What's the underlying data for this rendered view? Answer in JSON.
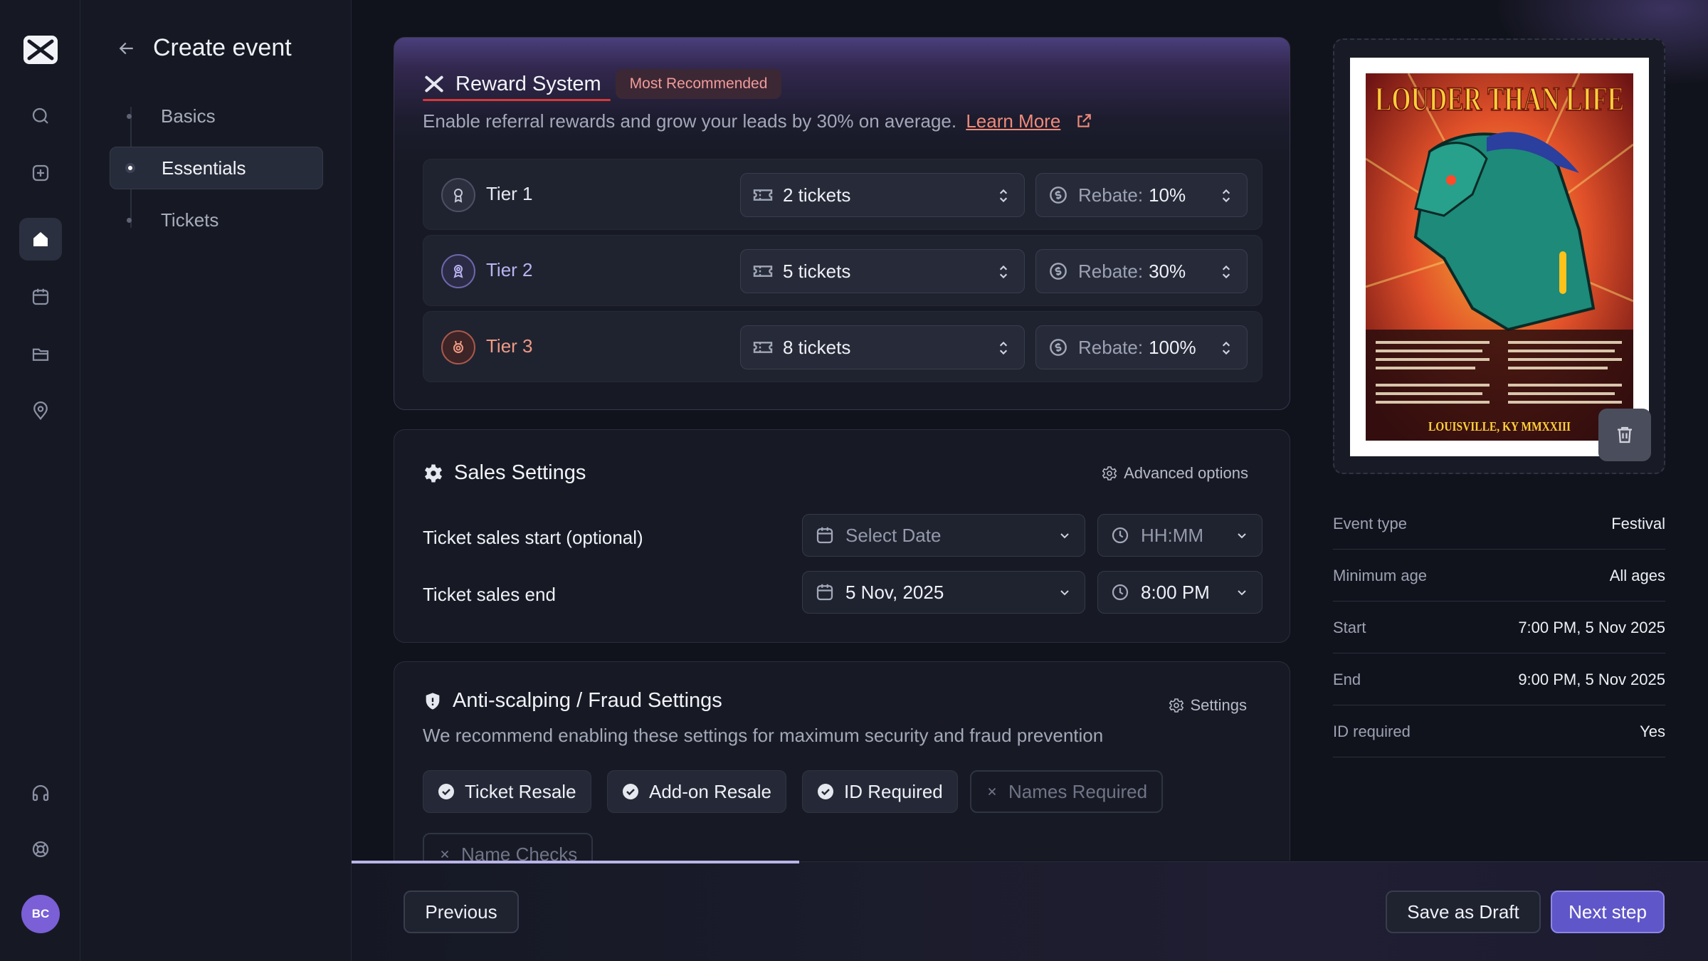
{
  "rail": {
    "avatar_initials": "BC",
    "icons": [
      "search-icon",
      "plus-square-icon",
      "home-icon",
      "calendar-icon",
      "folder-icon",
      "location-pin-icon",
      "headphones-icon",
      "lifebuoy-icon"
    ]
  },
  "steps": {
    "title": "Create event",
    "items": [
      {
        "label": "Basics",
        "active": false
      },
      {
        "label": "Essentials",
        "active": true
      },
      {
        "label": "Tickets",
        "active": false
      }
    ]
  },
  "reward": {
    "title": "Reward System",
    "badge": "Most Recommended",
    "description": "Enable referral rewards and grow your leads by 30% on average.",
    "learn_more": "Learn More",
    "tiers": [
      {
        "label": "Tier 1",
        "tickets": "2 tickets",
        "rebate_label": "Rebate:",
        "rebate": "10%",
        "color": "#e6e8ef"
      },
      {
        "label": "Tier 2",
        "tickets": "5 tickets",
        "rebate_label": "Rebate:",
        "rebate": "30%",
        "color": "#b9b4f0"
      },
      {
        "label": "Tier 3",
        "tickets": "8 tickets",
        "rebate_label": "Rebate:",
        "rebate": "100%",
        "color": "#f09a84"
      }
    ]
  },
  "sales": {
    "title": "Sales Settings",
    "advanced": "Advanced options",
    "start_label": "Ticket sales start (optional)",
    "start_date": "Select Date",
    "start_time": "HH:MM",
    "end_label": "Ticket sales end",
    "end_date": "5 Nov, 2025",
    "end_time": "8:00 PM"
  },
  "fraud": {
    "title": "Anti-scalping / Fraud Settings",
    "settings": "Settings",
    "description": "We recommend enabling these settings for maximum security and fraud prevention",
    "chips": [
      {
        "label": "Ticket Resale",
        "on": true
      },
      {
        "label": "Add-on Resale",
        "on": true
      },
      {
        "label": "ID Required",
        "on": true
      },
      {
        "label": "Names Required",
        "on": false
      },
      {
        "label": "Name Checks",
        "on": false
      }
    ]
  },
  "footer": {
    "previous": "Previous",
    "save_draft": "Save as Draft",
    "next": "Next step",
    "progress_fraction": 0.33
  },
  "poster": {
    "title": "LOUDER THAN LIFE",
    "location": "LOUISVILLE, KY MMXXIII"
  },
  "details": [
    {
      "key": "Event type",
      "value": "Festival"
    },
    {
      "key": "Minimum age",
      "value": "All ages"
    },
    {
      "key": "Start",
      "value": "7:00 PM, 5 Nov 2025"
    },
    {
      "key": "End",
      "value": "9:00 PM, 5 Nov 2025"
    },
    {
      "key": "ID required",
      "value": "Yes"
    }
  ]
}
